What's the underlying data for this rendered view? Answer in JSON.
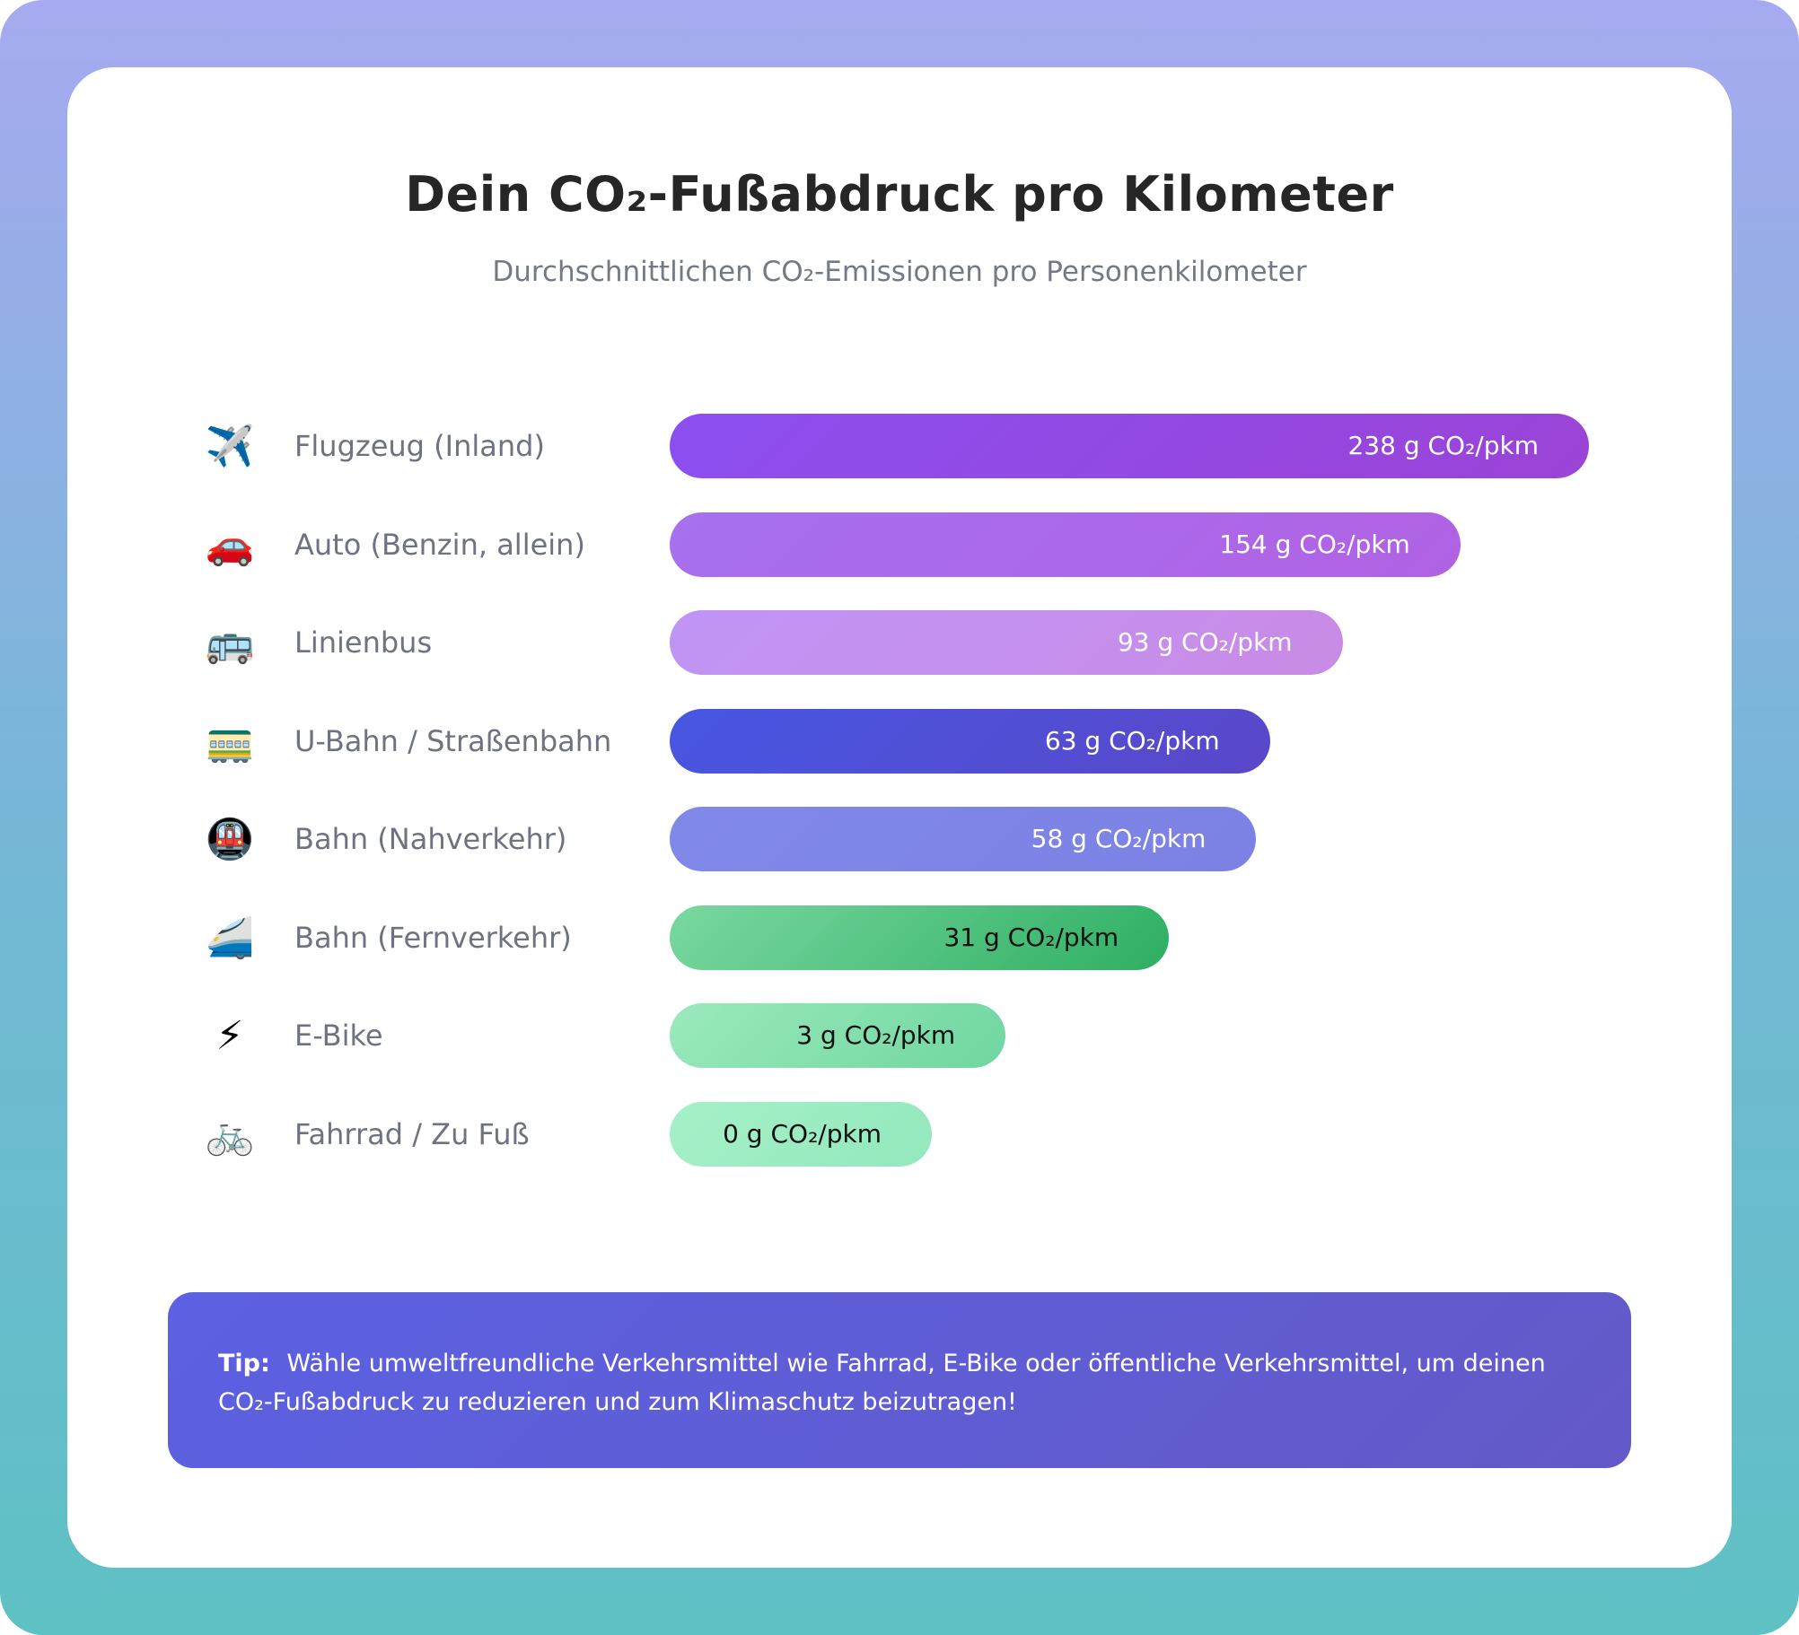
{
  "title": "Dein CO₂-Fußabdruck pro Kilometer",
  "subtitle": "Durchschnittlichen CO₂-Emissionen pro Personenkilometer",
  "chart_data": {
    "type": "bar",
    "orientation": "horizontal",
    "categories": [
      "Flugzeug (Inland)",
      "Auto (Benzin, allein)",
      "Linienbus",
      "U-Bahn / Straßenbahn",
      "Bahn (Nahverkehr)",
      "Bahn (Fernverkehr)",
      "E-Bike",
      "Fahrrad / Zu Fuß"
    ],
    "values": [
      238,
      154,
      93,
      63,
      58,
      31,
      3,
      0
    ],
    "unit": "g CO₂/pkm",
    "value_labels": [
      "238 g CO₂/pkm",
      "154 g CO₂/pkm",
      "93 g CO₂/pkm",
      "63 g CO₂/pkm",
      "58 g CO₂/pkm",
      "31 g CO₂/pkm",
      "3 g CO₂/pkm",
      "0 g CO₂/pkm"
    ],
    "icons": [
      "airplane-icon",
      "car-icon",
      "bus-icon",
      "tram-icon",
      "metro-icon",
      "high-speed-train-icon",
      "lightning-icon",
      "bicycle-icon"
    ],
    "icon_glyphs": [
      "✈️",
      "🚗",
      "🚌",
      "🚃",
      "🚇",
      "🚄",
      "⚡",
      "🚲"
    ],
    "colors": [
      [
        "#8b4ff0",
        "#9b43d6"
      ],
      [
        "#a670ef",
        "#b062e3"
      ],
      [
        "#c095f5",
        "#c98be6"
      ],
      [
        "#4757e2",
        "#5a47c9"
      ],
      [
        "#8088e8",
        "#7b82e4"
      ],
      [
        "#7ad8a0",
        "#2eaf63"
      ],
      [
        "#9be9bd",
        "#6fd6a0"
      ],
      [
        "#a6f0c8",
        "#92e8bc"
      ]
    ],
    "label_colors": [
      "#ffffff",
      "#ffffff",
      "#ffffff",
      "#ffffff",
      "#ffffff",
      "#111111",
      "#111111",
      "#111111"
    ]
  },
  "tip": {
    "label": "Tip:",
    "text": "Wähle umweltfreundliche Verkehrsmittel wie Fahrrad, E-Bike oder öffentliche Verkehrsmittel, um deinen CO₂-Fußabdruck zu reduzieren und zum Klimaschutz beizutragen!"
  }
}
